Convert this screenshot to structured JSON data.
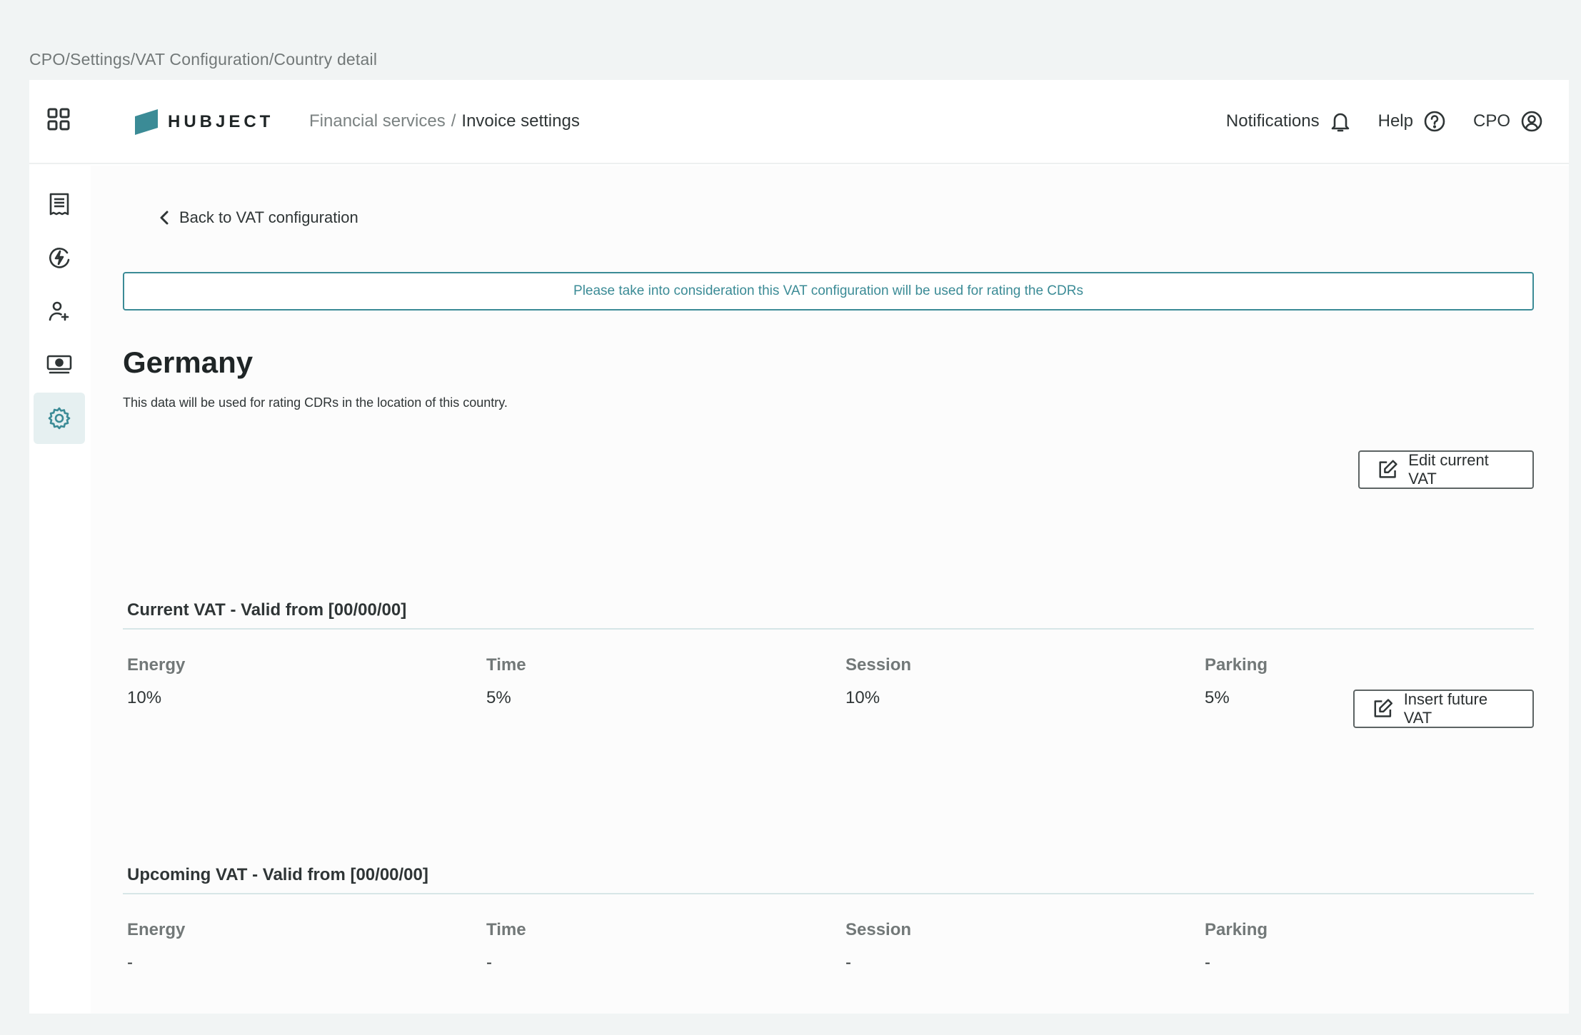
{
  "top_breadcrumb": "CPO/Settings/VAT Configuration/Country detail",
  "header": {
    "logo_text": "HUBJECT",
    "crumb_parent": "Financial services",
    "crumb_sep": "/",
    "crumb_current": "Invoice settings",
    "notifications_label": "Notifications",
    "help_label": "Help",
    "user_label": "CPO"
  },
  "sidebar": {
    "items": [
      {
        "icon": "document-list-icon",
        "active": false
      },
      {
        "icon": "charging-icon",
        "active": false
      },
      {
        "icon": "user-icon",
        "active": false
      },
      {
        "icon": "money-icon",
        "active": false
      },
      {
        "icon": "gear-icon",
        "active": true
      }
    ]
  },
  "main": {
    "back_label": "Back to VAT configuration",
    "notice": "Please take into consideration this VAT configuration will be used for rating the CDRs",
    "country": "Germany",
    "country_sub": "This data will be used for rating CDRs in the location of this country.",
    "edit_button": "Edit current VAT",
    "insert_button": "Insert future VAT",
    "current": {
      "title": "Current VAT - Valid from [00/00/00]",
      "columns": [
        {
          "label": "Energy",
          "value": "10%"
        },
        {
          "label": "Time",
          "value": "5%"
        },
        {
          "label": "Session",
          "value": "10%"
        },
        {
          "label": "Parking",
          "value": "5%"
        }
      ]
    },
    "upcoming": {
      "title": "Upcoming VAT - Valid from [00/00/00]",
      "columns": [
        {
          "label": "Energy",
          "value": "-"
        },
        {
          "label": "Time",
          "value": "-"
        },
        {
          "label": "Session",
          "value": "-"
        },
        {
          "label": "Parking",
          "value": "-"
        }
      ]
    }
  },
  "colors": {
    "accent": "#3b8b96",
    "background": "#f1f4f4",
    "active_bg": "#e6f0f1"
  }
}
